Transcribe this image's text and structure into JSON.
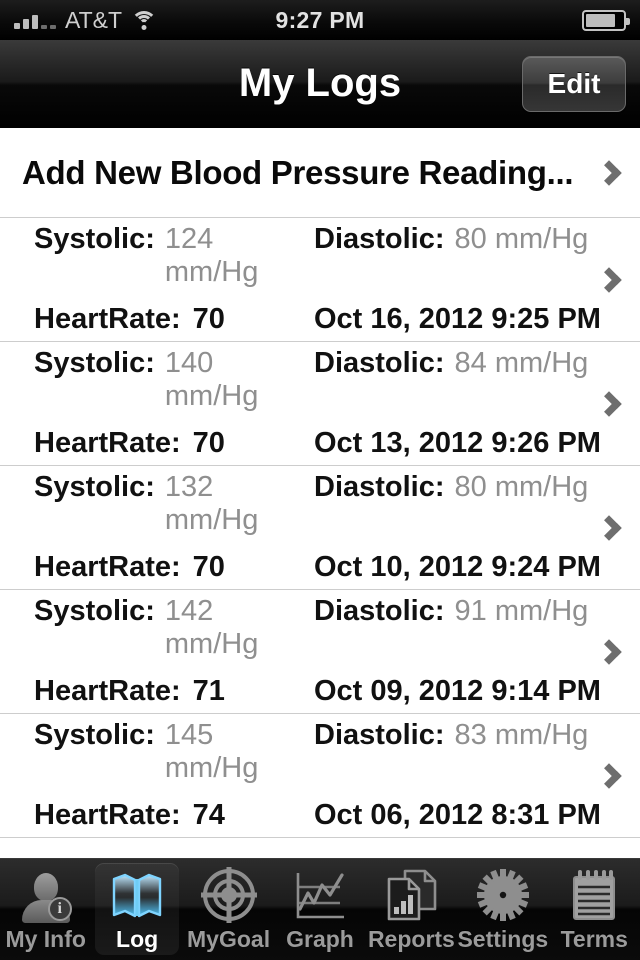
{
  "status_bar": {
    "carrier": "AT&T",
    "time": "9:27 PM",
    "signal_bars_filled": 3,
    "signal_bars_empty": 2,
    "wifi_icon": "wifi-icon",
    "battery_icon": "battery-icon",
    "battery_level_percent": 80
  },
  "nav_bar": {
    "title": "My Logs",
    "edit_label": "Edit"
  },
  "list": {
    "add_row": {
      "label": "Add New Blood Pressure Reading...",
      "chevron": "chevron-right-icon"
    },
    "labels": {
      "systolic": "Systolic:",
      "diastolic": "Diastolic:",
      "heart_rate": "HeartRate:"
    },
    "unit": "mm/Hg",
    "readings": [
      {
        "systolic": "124",
        "systolic_display": "124 mm/Hg",
        "diastolic": "80",
        "diastolic_display": "80 mm/Hg",
        "heart_rate": "70",
        "datetime": "Oct 16, 2012 9:25 PM"
      },
      {
        "systolic": "140",
        "systolic_display": "140 mm/Hg",
        "diastolic": "84",
        "diastolic_display": "84 mm/Hg",
        "heart_rate": "70",
        "datetime": "Oct 13, 2012 9:26 PM"
      },
      {
        "systolic": "132",
        "systolic_display": "132 mm/Hg",
        "diastolic": "80",
        "diastolic_display": "80 mm/Hg",
        "heart_rate": "70",
        "datetime": "Oct 10, 2012 9:24 PM"
      },
      {
        "systolic": "142",
        "systolic_display": "142 mm/Hg",
        "diastolic": "91",
        "diastolic_display": "91 mm/Hg",
        "heart_rate": "71",
        "datetime": "Oct 09, 2012 9:14 PM"
      },
      {
        "systolic": "145",
        "systolic_display": "145 mm/Hg",
        "diastolic": "83",
        "diastolic_display": "83 mm/Hg",
        "heart_rate": "74",
        "datetime": "Oct 06, 2012 8:31 PM"
      }
    ]
  },
  "tab_bar": {
    "selected": "Log",
    "items": [
      {
        "label": "My Info",
        "icon": "person-info-icon"
      },
      {
        "label": "Log",
        "icon": "open-book-icon"
      },
      {
        "label": "MyGoal",
        "icon": "target-icon"
      },
      {
        "label": "Graph",
        "icon": "line-chart-icon"
      },
      {
        "label": "Reports",
        "icon": "documents-chart-icon"
      },
      {
        "label": "Settings",
        "icon": "gear-icon"
      },
      {
        "label": "Terms",
        "icon": "notepad-icon"
      }
    ]
  },
  "colors": {
    "value_gray": "#8f8f8f",
    "text_black": "#111111",
    "separator": "#cdcdcd",
    "selected_tab_blue": "#4fc3f7",
    "tab_label_gray": "#9b9b9b"
  }
}
